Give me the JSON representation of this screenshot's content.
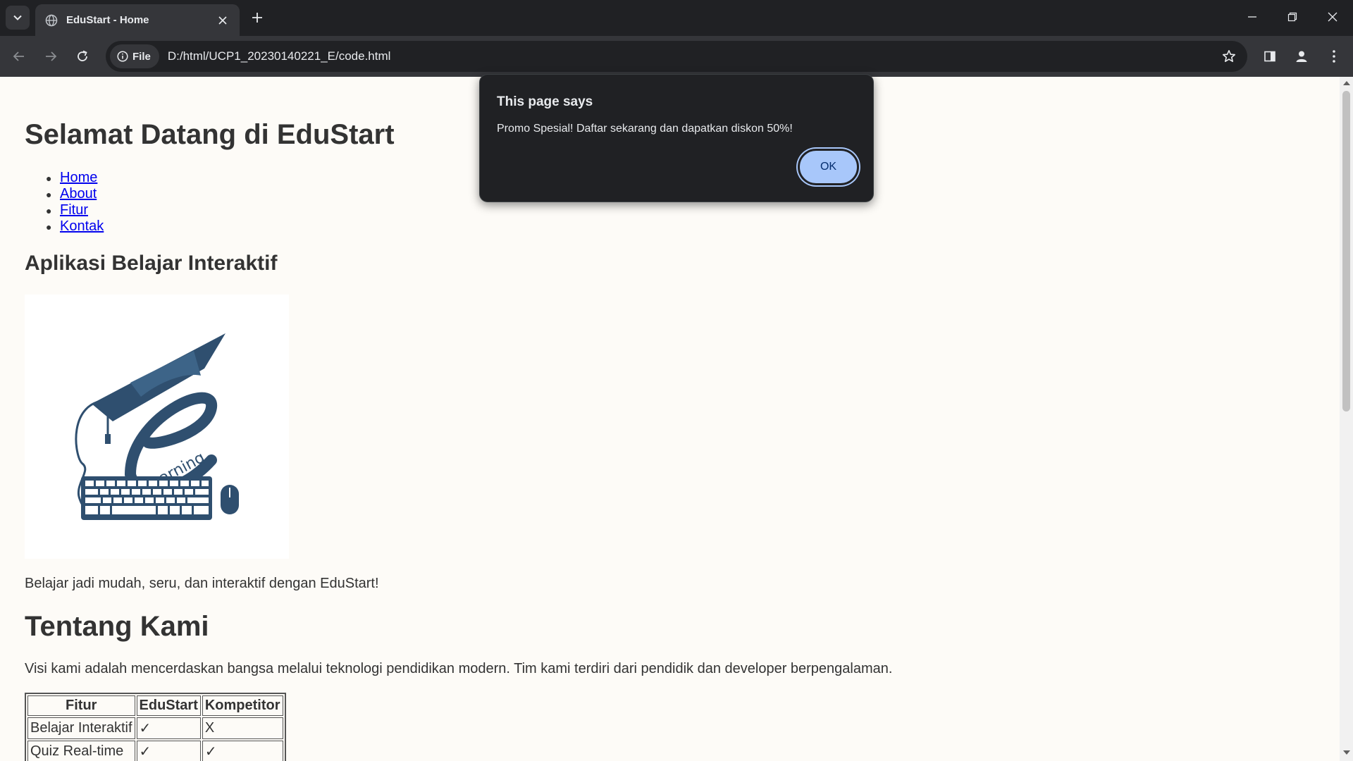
{
  "browser": {
    "tab_title": "EduStart - Home",
    "site_chip_label": "File",
    "url": "D:/html/UCP1_20230140221_E/code.html",
    "icons": [
      "tab-search-icon",
      "globe-icon",
      "close-icon",
      "plus-icon",
      "minimize-icon",
      "restore-icon",
      "back-icon",
      "forward-icon",
      "reload-icon",
      "info-icon",
      "star-icon",
      "sidepanel-icon",
      "profile-icon",
      "more-icon"
    ]
  },
  "page": {
    "title": "Selamat Datang di EduStart",
    "nav": [
      {
        "label": "Home"
      },
      {
        "label": "About"
      },
      {
        "label": "Fitur"
      },
      {
        "label": "Kontak"
      }
    ],
    "subtitle": "Aplikasi Belajar Interaktif",
    "logo_text": "learning",
    "tagline": "Belajar jadi mudah, seru, dan interaktif dengan EduStart!",
    "about_heading": "Tentang Kami",
    "about_text": "Visi kami adalah mencerdaskan bangsa melalui teknologi pendidikan modern. Tim kami terdiri dari pendidik dan developer berpengalaman.",
    "table": {
      "headers": [
        "Fitur",
        "EduStart",
        "Kompetitor"
      ],
      "rows": [
        [
          "Belajar Interaktif",
          "✓",
          "X"
        ],
        [
          "Quiz Real-time",
          "✓",
          "✓"
        ]
      ]
    }
  },
  "dialog": {
    "title": "This page says",
    "message": "Promo Spesial! Daftar sekarang dan dapatkan diskon 50%!",
    "ok_label": "OK"
  },
  "colors": {
    "chrome_dark": "#202124",
    "chrome_toolbar": "#35363a",
    "page_bg": "#fdfbf7",
    "link": "#0000ee",
    "logo_navy": "#2f4f6f",
    "ok_button": "#a8c7fa"
  }
}
